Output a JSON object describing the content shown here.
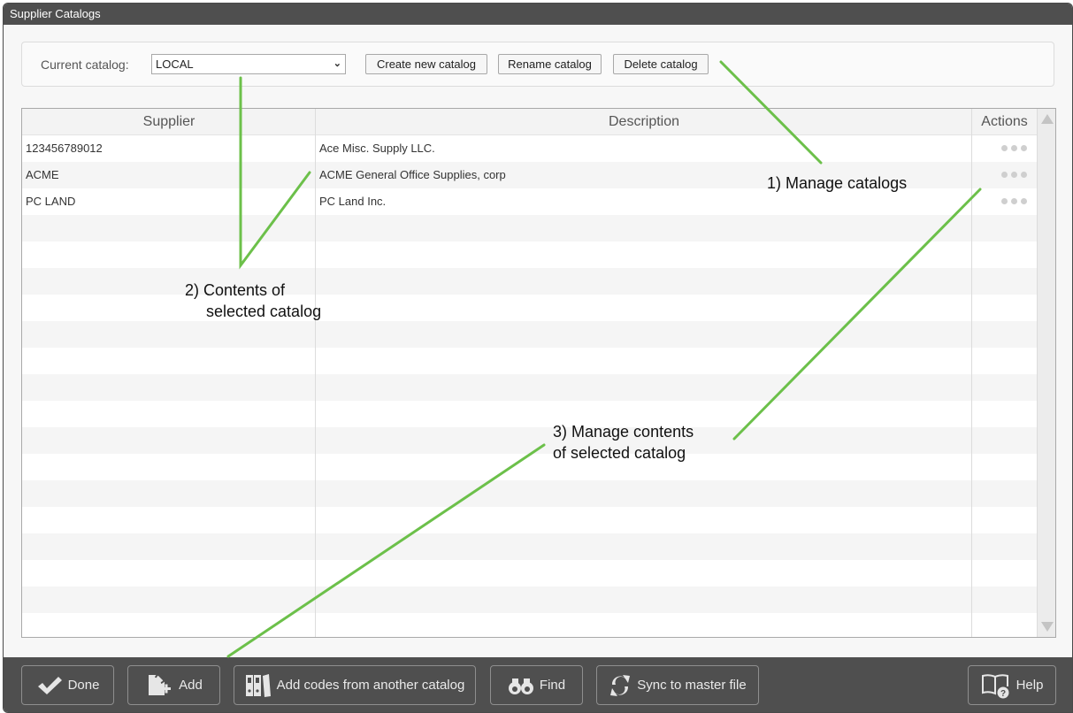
{
  "window": {
    "title": "Supplier Catalogs"
  },
  "catalog_bar": {
    "label": "Current catalog:",
    "selected": "LOCAL",
    "buttons": {
      "create": "Create new catalog",
      "rename": "Rename catalog",
      "delete": "Delete catalog"
    }
  },
  "grid": {
    "columns": {
      "supplier": "Supplier",
      "description": "Description",
      "actions": "Actions"
    },
    "rows": [
      {
        "supplier": "123456789012",
        "description": "Ace Misc. Supply LLC."
      },
      {
        "supplier": "ACME",
        "description": "ACME General Office Supplies, corp"
      },
      {
        "supplier": "PC LAND",
        "description": "PC Land Inc."
      }
    ],
    "actions_icon": "more-horizontal-icon"
  },
  "footer": {
    "done": {
      "label": "Done",
      "icon": "checkmark-icon"
    },
    "add": {
      "label": "Add",
      "icon": "add-document-icon"
    },
    "add_codes": {
      "label": "Add codes from another catalog",
      "icon": "binders-icon"
    },
    "find": {
      "label": "Find",
      "icon": "binoculars-icon"
    },
    "sync": {
      "label": "Sync to master file",
      "icon": "sync-icon"
    },
    "help": {
      "label": "Help",
      "icon": "help-book-icon"
    }
  },
  "annotations": {
    "a1": "1) Manage catalogs",
    "a2_line1": "2) Contents of",
    "a2_line2": "selected catalog",
    "a3_line1": "3) Manage contents",
    "a3_line2": "of selected catalog",
    "color": "#6cc04a"
  }
}
